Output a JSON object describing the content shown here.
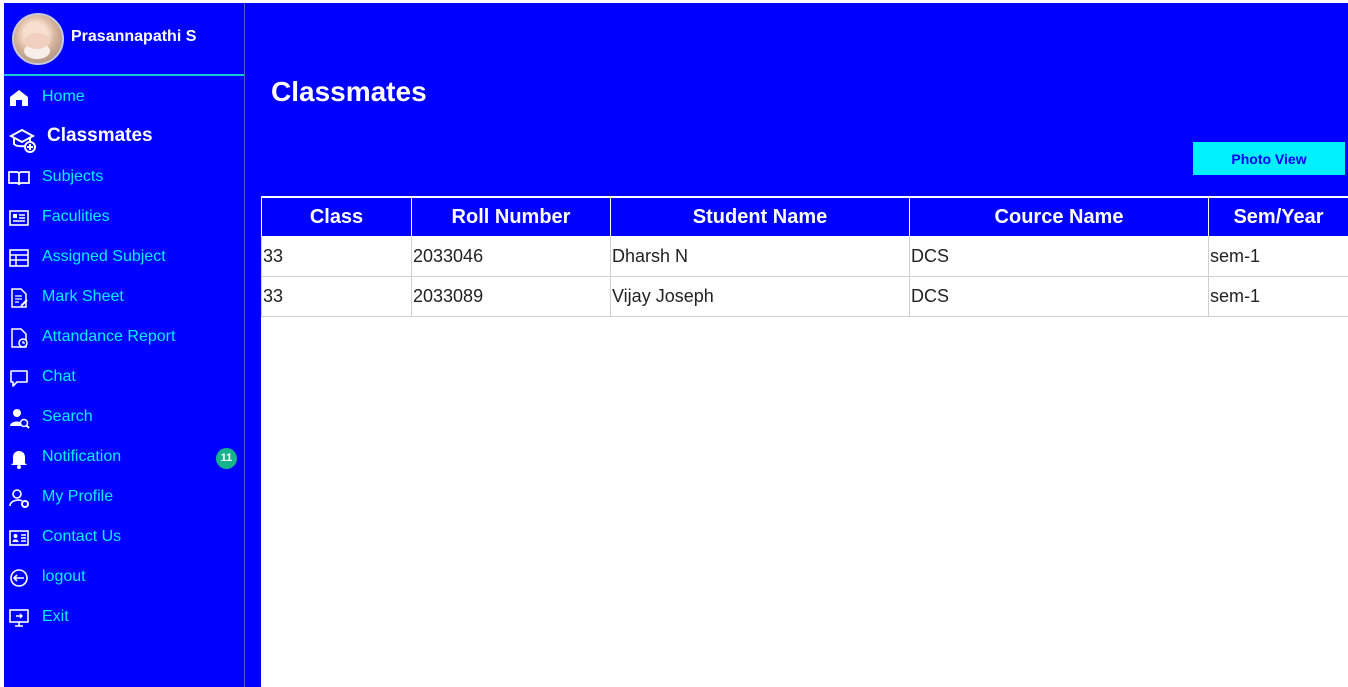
{
  "colors": {
    "primary": "#0000fe",
    "accent": "#00f0ff",
    "badge": "#17b38c",
    "text_on_primary": "#ffffff"
  },
  "user": {
    "name": "Prasannapathi S",
    "avatar_icon": "profile-photo"
  },
  "sidebar": {
    "items": [
      {
        "label": "Home",
        "icon": "home-icon",
        "active": false
      },
      {
        "label": "Classmates",
        "icon": "classmates-icon",
        "active": true
      },
      {
        "label": "Subjects",
        "icon": "book-icon",
        "active": false
      },
      {
        "label": "Faculities",
        "icon": "faculty-list-icon",
        "active": false
      },
      {
        "label": "Assigned Subject",
        "icon": "assigned-subject-icon",
        "active": false
      },
      {
        "label": "Mark Sheet",
        "icon": "document-edit-icon",
        "active": false
      },
      {
        "label": "Attandance Report",
        "icon": "report-clock-icon",
        "active": false
      },
      {
        "label": "Chat",
        "icon": "chat-icon",
        "active": false
      },
      {
        "label": "Search",
        "icon": "user-search-icon",
        "active": false
      },
      {
        "label": "Notification",
        "icon": "bell-icon",
        "active": false,
        "badge": "11"
      },
      {
        "label": "My Profile",
        "icon": "user-settings-icon",
        "active": false
      },
      {
        "label": "Contact Us",
        "icon": "contact-card-icon",
        "active": false
      },
      {
        "label": "logout",
        "icon": "logout-icon",
        "active": false
      },
      {
        "label": "Exit",
        "icon": "monitor-exit-icon",
        "active": false
      }
    ]
  },
  "main": {
    "title": "Classmates",
    "photo_view_label": "Photo View",
    "table": {
      "headers": [
        "Class",
        "Roll Number",
        "Student Name",
        "Cource Name",
        "Sem/Year"
      ],
      "rows": [
        [
          "33",
          "2033046",
          "Dharsh N",
          "DCS",
          "sem-1"
        ],
        [
          "33",
          "2033089",
          "Vijay Joseph",
          "DCS",
          "sem-1"
        ]
      ]
    }
  }
}
